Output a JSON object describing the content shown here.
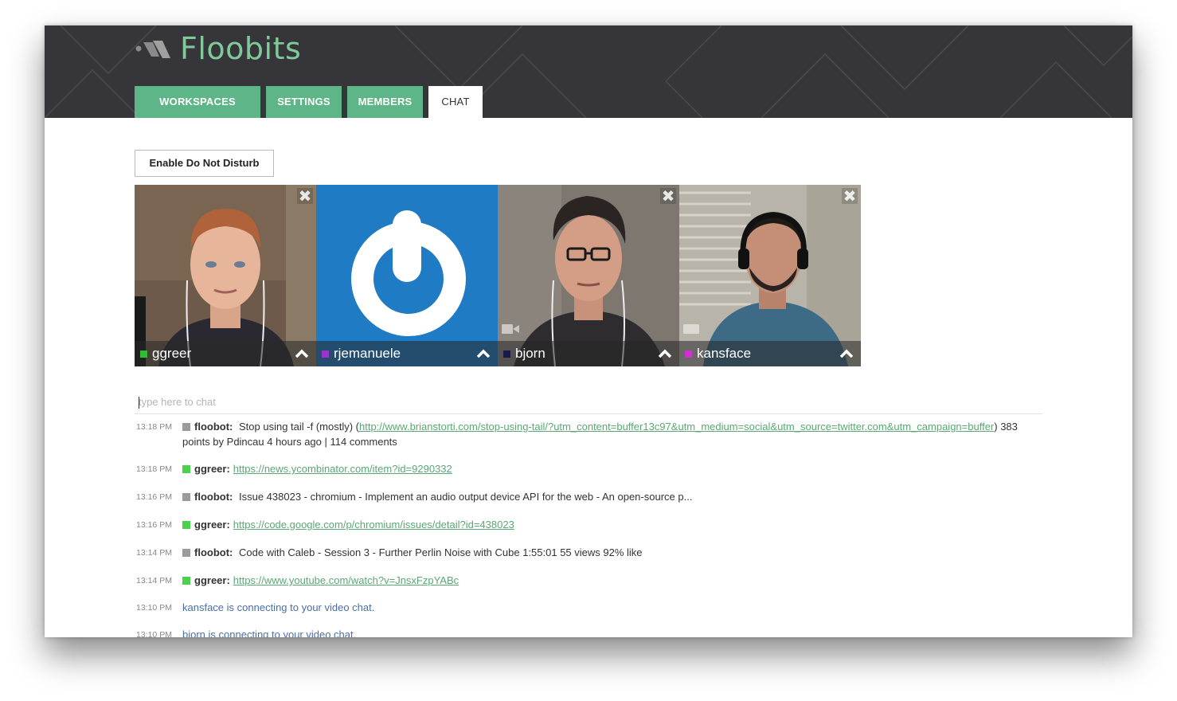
{
  "app": {
    "name": "Floobits"
  },
  "colors": {
    "brand_green": "#5eb587",
    "logo_green": "#7fc99a",
    "header_bg": "#35353a",
    "link": "#5aa874",
    "system_text": "#4a6fa5"
  },
  "tabs": [
    {
      "label": "WORKSPACES",
      "active": false
    },
    {
      "label": "SETTINGS",
      "active": false
    },
    {
      "label": "MEMBERS",
      "active": false
    },
    {
      "label": "CHAT",
      "active": true
    }
  ],
  "dnd_button": {
    "label": "Enable Do Not Disturb"
  },
  "videos": [
    {
      "name": "ggreer",
      "color": "#33bb33",
      "icon": "close-icon"
    },
    {
      "name": "rjemanuele",
      "color": "#9933cc",
      "icon": "close-icon"
    },
    {
      "name": "bjorn",
      "color": "#1a1a4a",
      "icon": "close-icon"
    },
    {
      "name": "kansface",
      "color": "#cc33cc",
      "icon": "close-icon"
    }
  ],
  "chat_input": {
    "placeholder": "type here to chat"
  },
  "messages": [
    {
      "time": "13:18 PM",
      "user": "floobot:",
      "color": "gray",
      "text_before": "Stop using tail -f (mostly) (",
      "link": "http://www.brianstorti.com/stop-using-tail/?utm_content=buffer13c97&utm_medium=social&utm_source=twitter.com&utm_campaign=buffer",
      "text_after": ") 383 points by Pdincau 4 hours ago | 114 comments"
    },
    {
      "time": "13:18 PM",
      "user": "ggreer:",
      "color": "green",
      "link": "https://news.ycombinator.com/item?id=9290332"
    },
    {
      "time": "13:16 PM",
      "user": "floobot:",
      "color": "gray",
      "text": "Issue 438023 - chromium - Implement an audio output device API for the web - An open-source p..."
    },
    {
      "time": "13:16 PM",
      "user": "ggreer:",
      "color": "green",
      "link": "https://code.google.com/p/chromium/issues/detail?id=438023"
    },
    {
      "time": "13:14 PM",
      "user": "floobot:",
      "color": "gray",
      "text": "Code with Caleb - Session 3 - Further Perlin Noise with Cube 1:55:01 55 views 92% like"
    },
    {
      "time": "13:14 PM",
      "user": "ggreer:",
      "color": "green",
      "link": "https://www.youtube.com/watch?v=JnsxFzpYABc"
    },
    {
      "time": "13:10 PM",
      "system": "kansface is connecting to your video chat."
    },
    {
      "time": "13:10 PM",
      "system": "bjorn is connecting to your video chat."
    }
  ]
}
